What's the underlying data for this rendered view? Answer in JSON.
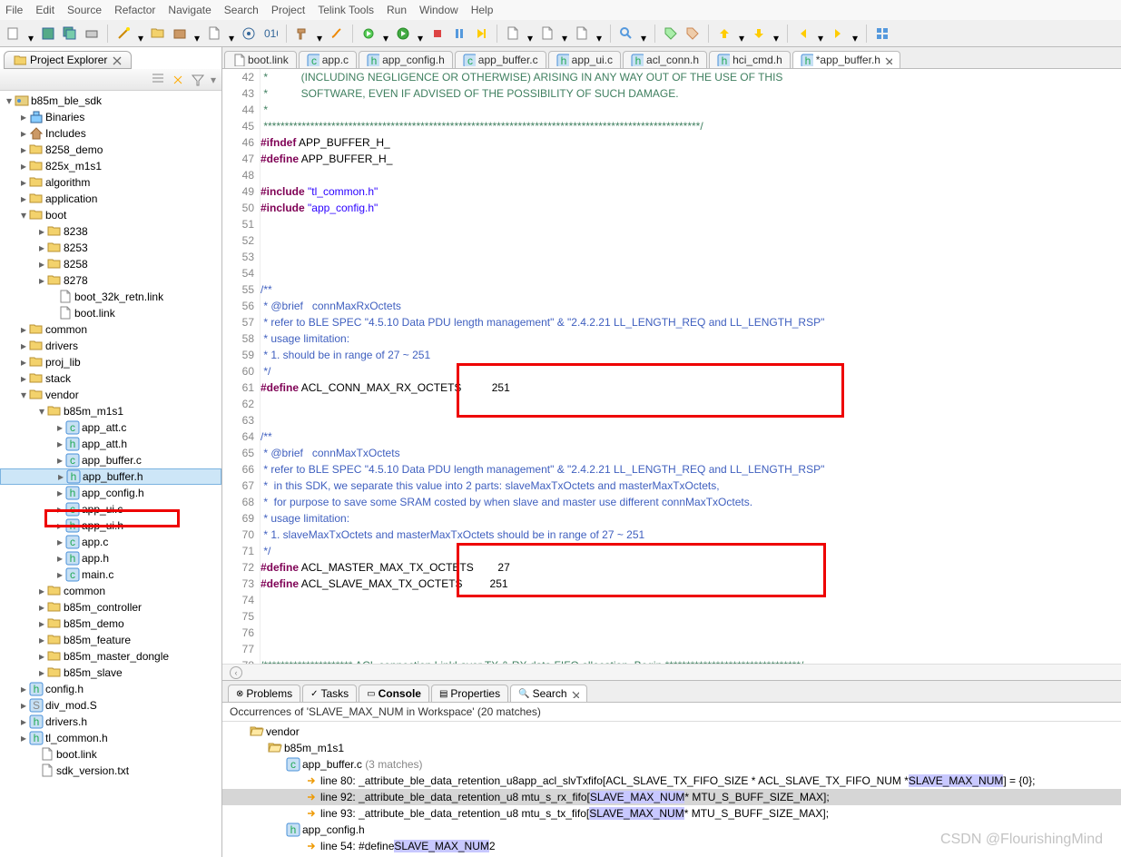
{
  "menu": [
    "File",
    "Edit",
    "Source",
    "Refactor",
    "Navigate",
    "Search",
    "Project",
    "Telink Tools",
    "Run",
    "Window",
    "Help"
  ],
  "sidebar": {
    "title": "Project Explorer",
    "project": "b85m_ble_sdk",
    "nodes": [
      {
        "pad": 20,
        "tw": ">",
        "ico": "bin",
        "label": "Binaries"
      },
      {
        "pad": 20,
        "tw": ">",
        "ico": "inc",
        "label": "Includes"
      },
      {
        "pad": 20,
        "tw": ">",
        "ico": "fld",
        "label": "8258_demo"
      },
      {
        "pad": 20,
        "tw": ">",
        "ico": "fld",
        "label": "825x_m1s1"
      },
      {
        "pad": 20,
        "tw": ">",
        "ico": "fld",
        "label": "algorithm"
      },
      {
        "pad": 20,
        "tw": ">",
        "ico": "fld",
        "label": "application"
      },
      {
        "pad": 20,
        "tw": "v",
        "ico": "fld",
        "label": "boot"
      },
      {
        "pad": 40,
        "tw": ">",
        "ico": "fld",
        "label": "8238"
      },
      {
        "pad": 40,
        "tw": ">",
        "ico": "fld",
        "label": "8253"
      },
      {
        "pad": 40,
        "tw": ">",
        "ico": "fld",
        "label": "8258"
      },
      {
        "pad": 40,
        "tw": ">",
        "ico": "fld",
        "label": "8278"
      },
      {
        "pad": 52,
        "tw": "",
        "ico": "file",
        "label": "boot_32k_retn.link"
      },
      {
        "pad": 52,
        "tw": "",
        "ico": "file",
        "label": "boot.link"
      },
      {
        "pad": 20,
        "tw": ">",
        "ico": "fld",
        "label": "common"
      },
      {
        "pad": 20,
        "tw": ">",
        "ico": "fld",
        "label": "drivers"
      },
      {
        "pad": 20,
        "tw": ">",
        "ico": "fld",
        "label": "proj_lib"
      },
      {
        "pad": 20,
        "tw": ">",
        "ico": "fld",
        "label": "stack"
      },
      {
        "pad": 20,
        "tw": "v",
        "ico": "fld",
        "label": "vendor"
      },
      {
        "pad": 40,
        "tw": "v",
        "ico": "fld",
        "label": "b85m_m1s1"
      },
      {
        "pad": 60,
        "tw": ">",
        "ico": "c",
        "label": "app_att.c"
      },
      {
        "pad": 60,
        "tw": ">",
        "ico": "h",
        "label": "app_att.h"
      },
      {
        "pad": 60,
        "tw": ">",
        "ico": "c",
        "label": "app_buffer.c"
      },
      {
        "pad": 60,
        "tw": ">",
        "ico": "h",
        "label": "app_buffer.h",
        "sel": true
      },
      {
        "pad": 60,
        "tw": ">",
        "ico": "h",
        "label": "app_config.h"
      },
      {
        "pad": 60,
        "tw": ">",
        "ico": "c",
        "label": "app_ui.c"
      },
      {
        "pad": 60,
        "tw": ">",
        "ico": "h",
        "label": "app_ui.h"
      },
      {
        "pad": 60,
        "tw": ">",
        "ico": "c",
        "label": "app.c"
      },
      {
        "pad": 60,
        "tw": ">",
        "ico": "h",
        "label": "app.h"
      },
      {
        "pad": 60,
        "tw": ">",
        "ico": "c",
        "label": "main.c"
      },
      {
        "pad": 40,
        "tw": ">",
        "ico": "fld",
        "label": "common"
      },
      {
        "pad": 40,
        "tw": ">",
        "ico": "fld",
        "label": "b85m_controller"
      },
      {
        "pad": 40,
        "tw": ">",
        "ico": "fld",
        "label": "b85m_demo"
      },
      {
        "pad": 40,
        "tw": ">",
        "ico": "fld",
        "label": "b85m_feature"
      },
      {
        "pad": 40,
        "tw": ">",
        "ico": "fld",
        "label": "b85m_master_dongle"
      },
      {
        "pad": 40,
        "tw": ">",
        "ico": "fld",
        "label": "b85m_slave"
      },
      {
        "pad": 20,
        "tw": ">",
        "ico": "h",
        "label": "config.h"
      },
      {
        "pad": 20,
        "tw": ">",
        "ico": "s",
        "label": "div_mod.S"
      },
      {
        "pad": 20,
        "tw": ">",
        "ico": "h",
        "label": "drivers.h"
      },
      {
        "pad": 20,
        "tw": ">",
        "ico": "h",
        "label": "tl_common.h"
      },
      {
        "pad": 32,
        "tw": "",
        "ico": "file",
        "label": "boot.link"
      },
      {
        "pad": 32,
        "tw": "",
        "ico": "file",
        "label": "sdk_version.txt"
      }
    ]
  },
  "tabs": [
    {
      "ico": "file",
      "label": "boot.link"
    },
    {
      "ico": "c",
      "label": "app.c"
    },
    {
      "ico": "h",
      "label": "app_config.h"
    },
    {
      "ico": "c",
      "label": "app_buffer.c"
    },
    {
      "ico": "h",
      "label": "app_ui.c"
    },
    {
      "ico": "h",
      "label": "acl_conn.h"
    },
    {
      "ico": "h",
      "label": "hci_cmd.h"
    },
    {
      "ico": "h",
      "label": "*app_buffer.h",
      "active": true,
      "close": true
    }
  ],
  "code": {
    "start": 42,
    "lines": [
      {
        "n": 42,
        "cls": "cmt",
        "t": " *           (INCLUDING NEGLIGENCE OR OTHERWISE) ARISING IN ANY WAY OUT OF THE USE OF THIS"
      },
      {
        "n": 43,
        "cls": "cmt",
        "t": " *           SOFTWARE, EVEN IF ADVISED OF THE POSSIBILITY OF SUCH DAMAGE."
      },
      {
        "n": 44,
        "cls": "cmt",
        "t": " *"
      },
      {
        "n": 45,
        "cls": "cmt",
        "t": " *******************************************************************************************************/"
      },
      {
        "n": 46,
        "html": "<span class='kw'>#ifndef</span> APP_BUFFER_H_"
      },
      {
        "n": 47,
        "html": "<span class='kw'>#define</span> APP_BUFFER_H_"
      },
      {
        "n": 48,
        "t": ""
      },
      {
        "n": 49,
        "html": "<span class='kw'>#include</span> <span class='str'>\"tl_common.h\"</span>"
      },
      {
        "n": 50,
        "html": "<span class='kw'>#include</span> <span class='str'>\"app_config.h\"</span>"
      },
      {
        "n": 51,
        "t": ""
      },
      {
        "n": 52,
        "t": ""
      },
      {
        "n": 53,
        "t": ""
      },
      {
        "n": 54,
        "t": ""
      },
      {
        "n": 55,
        "cls": "doc",
        "t": "/**"
      },
      {
        "n": 56,
        "cls": "doc",
        "t": " * @brief   connMaxRxOctets"
      },
      {
        "n": 57,
        "cls": "doc",
        "t": " * refer to BLE SPEC \"4.5.10 Data PDU length management\" & \"2.4.2.21 LL_LENGTH_REQ and LL_LENGTH_RSP\""
      },
      {
        "n": 58,
        "cls": "doc",
        "t": " * usage limitation:"
      },
      {
        "n": 59,
        "cls": "doc",
        "t": " * 1. should be in range of 27 ~ 251"
      },
      {
        "n": 60,
        "cls": "doc",
        "t": " */"
      },
      {
        "n": 61,
        "html": "<span class='kw'>#define</span> ACL_CONN_MAX_RX_OCTETS          251"
      },
      {
        "n": 62,
        "t": ""
      },
      {
        "n": 63,
        "t": ""
      },
      {
        "n": 64,
        "cls": "doc",
        "t": "/**"
      },
      {
        "n": 65,
        "cls": "doc",
        "t": " * @brief   connMaxTxOctets"
      },
      {
        "n": 66,
        "cls": "doc",
        "t": " * refer to BLE SPEC \"4.5.10 Data PDU length management\" & \"2.4.2.21 LL_LENGTH_REQ and LL_LENGTH_RSP\""
      },
      {
        "n": 67,
        "cls": "doc",
        "t": " *  in this SDK, we separate this value into 2 parts: slaveMaxTxOctets and masterMaxTxOctets,"
      },
      {
        "n": 68,
        "cls": "doc",
        "t": " *  for purpose to save some SRAM costed by when slave and master use different connMaxTxOctets."
      },
      {
        "n": 69,
        "cls": "doc",
        "t": " * usage limitation:"
      },
      {
        "n": 70,
        "cls": "doc",
        "t": " * 1. slaveMaxTxOctets and masterMaxTxOctets should be in range of 27 ~ 251"
      },
      {
        "n": 71,
        "cls": "doc",
        "t": " */"
      },
      {
        "n": 72,
        "html": "<span class='kw'>#define</span> ACL_MASTER_MAX_TX_OCTETS        27"
      },
      {
        "n": 73,
        "html": "<span class='kw'>#define</span> ACL_SLAVE_MAX_TX_OCTETS         251"
      },
      {
        "n": 74,
        "t": ""
      },
      {
        "n": 75,
        "t": ""
      },
      {
        "n": 76,
        "t": ""
      },
      {
        "n": 77,
        "t": ""
      },
      {
        "n": 78,
        "cls": "cmt",
        "t": "/********************* ACL connection LinkLayer TX & RX data FIFO allocation, Begin ********************************/"
      },
      {
        "n": 79,
        "cls": "doc",
        "t": "/**"
      }
    ]
  },
  "bottom": {
    "tabs": [
      "Problems",
      "Tasks",
      "Console",
      "Properties",
      "Search"
    ],
    "active_tab": 4,
    "head": "Occurrences of 'SLAVE_MAX_NUM in Workspace' (20 matches)",
    "vendor": "vendor",
    "proj": "b85m_m1s1",
    "f1": "app_buffer.c",
    "f1m": "(3 matches)",
    "f2": "app_config.h",
    "l80_a": "line 80:  _attribute_ble_data_retention_u8app_acl_slvTxfifo[ACL_SLAVE_TX_FIFO_SIZE * ACL_SLAVE_TX_FIFO_NUM * ",
    "l80_h": "SLAVE_MAX_NUM",
    "l80_b": "] = {0};",
    "l92_a": "line 92:  _attribute_ble_data_retention_u8 mtu_s_rx_fifo[",
    "l92_h": "SLAVE_MAX_NUM",
    "l92_b": " * MTU_S_BUFF_SIZE_MAX];",
    "l93_a": "line 93:  _attribute_ble_data_retention_u8 mtu_s_tx_fifo[",
    "l93_h": "SLAVE_MAX_NUM",
    "l93_b": " * MTU_S_BUFF_SIZE_MAX];",
    "l54_a": "line 54:  #define ",
    "l54_h": "SLAVE_MAX_NUM",
    "l54_b": "2"
  },
  "watermark": "CSDN @FlourishingMind"
}
